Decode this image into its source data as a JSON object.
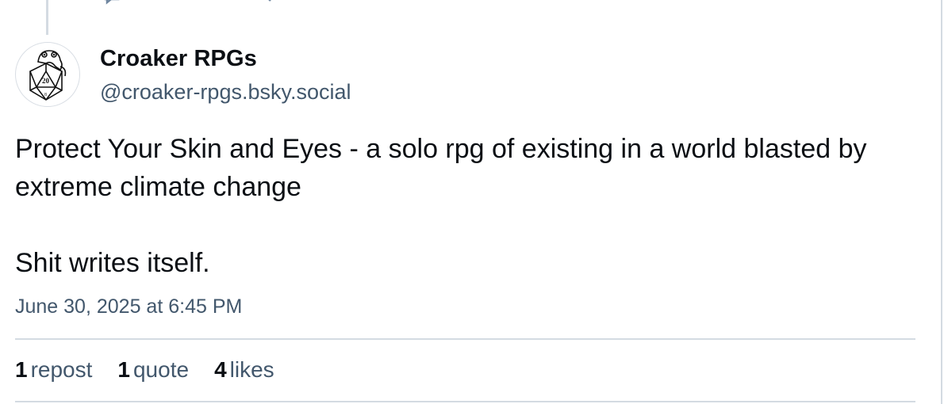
{
  "author": {
    "display_name": "Croaker RPGs",
    "handle": "@croaker-rpgs.bsky.social"
  },
  "post": {
    "paragraphs": [
      "Protect Your Skin and Eyes - a solo rpg of existing in a world blasted by extreme climate change",
      "Shit writes itself."
    ],
    "timestamp": "June 30, 2025 at 6:45 PM"
  },
  "stats": [
    {
      "count": "1",
      "label": "repost"
    },
    {
      "count": "1",
      "label": "quote"
    },
    {
      "count": "4",
      "label": "likes"
    }
  ],
  "colors": {
    "text": "#0b0f14",
    "secondary_text": "#42576c",
    "border": "#d4dbe2",
    "like_accent": "#ec4899",
    "icon_gray": "#6f869f"
  },
  "icons": [
    "reply-icon",
    "repost-icon",
    "like-icon-filled",
    "bookmark-icon"
  ]
}
